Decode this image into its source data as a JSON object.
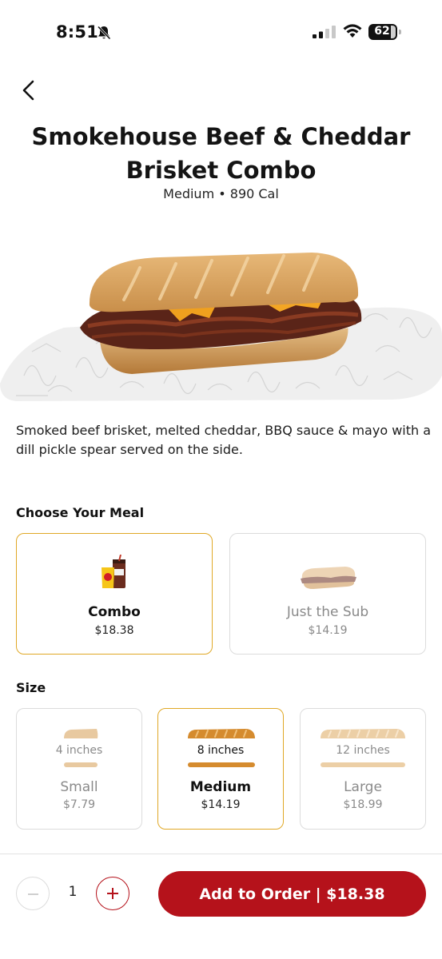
{
  "status_bar": {
    "time": "8:51",
    "battery": "62",
    "icons": [
      "bell-slash-icon",
      "signal-icon",
      "wifi-icon",
      "battery-icon"
    ]
  },
  "header": {
    "back_icon": "chevron-left-icon",
    "title": "Smokehouse Beef & Cheddar Brisket Combo",
    "subtitle": "Medium • 890 Cal"
  },
  "product": {
    "description": "Smoked beef brisket, melted cheddar, BBQ sauce & mayo with a dill pickle spear served on the side."
  },
  "meal": {
    "label": "Choose Your Meal",
    "options": [
      {
        "name": "Combo",
        "price": "$18.38",
        "selected": true
      },
      {
        "name": "Just the Sub",
        "price": "$14.19",
        "selected": false
      }
    ]
  },
  "size": {
    "label": "Size",
    "options": [
      {
        "inches": "4 inches",
        "name": "Small",
        "price": "$7.79",
        "selected": false
      },
      {
        "inches": "8 inches",
        "name": "Medium",
        "price": "$14.19",
        "selected": true
      },
      {
        "inches": "12 inches",
        "name": "Large",
        "price": "$18.99",
        "selected": false
      }
    ]
  },
  "footer": {
    "quantity": "1",
    "add_button": "Add to Order | $18.38"
  },
  "colors": {
    "accent": "#b5121b",
    "selected_border": "#e0a826"
  }
}
